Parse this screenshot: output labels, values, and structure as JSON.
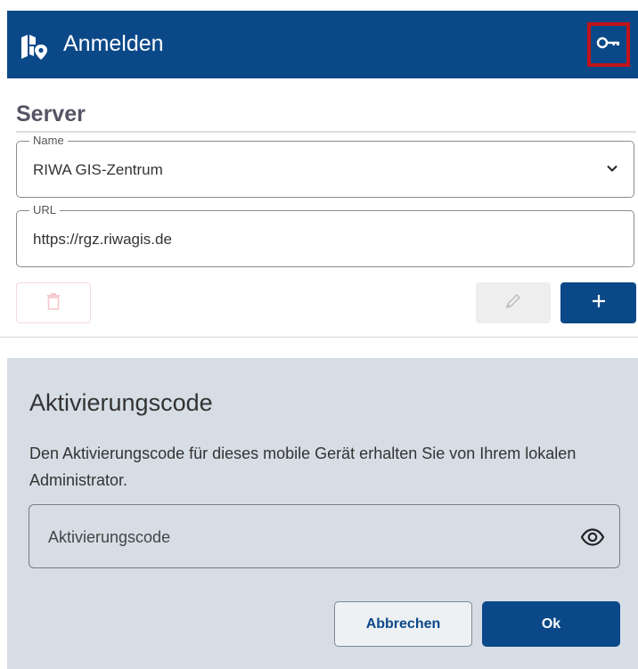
{
  "appbar": {
    "title": "Anmelden",
    "logo_icon": "map-pin-icon",
    "key_icon": "key-icon"
  },
  "server_section": {
    "title": "Server",
    "name_field": {
      "label": "Name",
      "value": "RIWA GIS-Zentrum"
    },
    "url_field": {
      "label": "URL",
      "value": "https://rgz.riwagis.de"
    },
    "buttons": {
      "delete_icon": "trash-icon",
      "edit_icon": "pencil-icon",
      "add_icon": "plus-icon"
    }
  },
  "dialog": {
    "title": "Aktivierungscode",
    "description": "Den Aktivierungscode für dieses mobile Gerät erhalten Sie von Ihrem lokalen Administrator.",
    "input_placeholder": "Aktivierungscode",
    "visibility_icon": "eye-icon",
    "cancel_label": "Abbrechen",
    "ok_label": "Ok"
  },
  "colors": {
    "primary": "#0b4888",
    "highlight_border": "#c0141a",
    "dialog_bg": "#d6dde5"
  }
}
